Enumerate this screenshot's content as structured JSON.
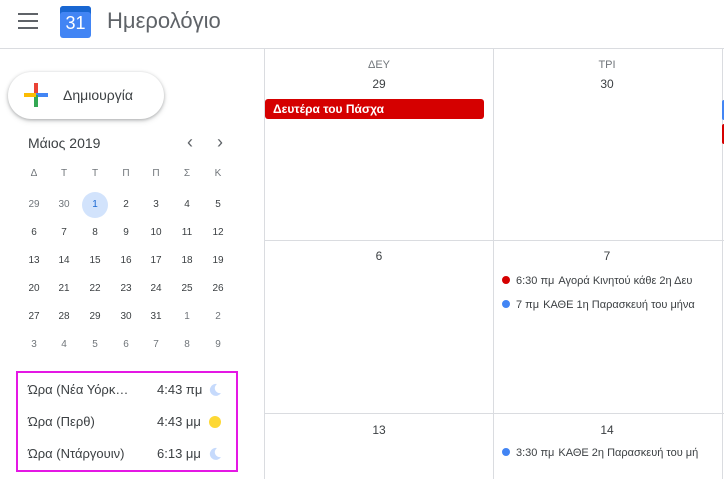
{
  "header": {
    "app_title": "Ημερολόγιο",
    "logo_day": "31"
  },
  "create_button": {
    "label": "Δημιουργία"
  },
  "mini_calendar": {
    "title": "Μάιος 2019",
    "prev": "‹",
    "next": "›",
    "weekday_headers": [
      "Δ",
      "Τ",
      "Τ",
      "Π",
      "Π",
      "Σ",
      "Κ"
    ],
    "weeks": [
      [
        "29",
        "30",
        "1",
        "2",
        "3",
        "4",
        "5"
      ],
      [
        "6",
        "7",
        "8",
        "9",
        "10",
        "11",
        "12"
      ],
      [
        "13",
        "14",
        "15",
        "16",
        "17",
        "18",
        "19"
      ],
      [
        "20",
        "21",
        "22",
        "23",
        "24",
        "25",
        "26"
      ],
      [
        "27",
        "28",
        "29",
        "30",
        "31",
        "1",
        "2"
      ],
      [
        "3",
        "4",
        "5",
        "6",
        "7",
        "8",
        "9"
      ]
    ],
    "today": "1"
  },
  "timezones": [
    {
      "name": "Ώρα (Νέα Υόρκ…",
      "time": "4:43 πμ",
      "icon": "moon-icon"
    },
    {
      "name": "Ώρα (Περθ)",
      "time": "4:43 μμ",
      "icon": "sun-icon"
    },
    {
      "name": "Ώρα (Ντάργουιν)",
      "time": "6:13 μμ",
      "icon": "moon-icon"
    }
  ],
  "calendar": {
    "columns": [
      {
        "dow": "ΔΕΥ",
        "dates": [
          "29",
          "6",
          "13"
        ]
      },
      {
        "dow": "ΤΡΙ",
        "dates": [
          "30",
          "7",
          "14"
        ]
      }
    ],
    "allday_event": {
      "title": "Δευτέρα του Πάσχα",
      "color": "#d50000"
    },
    "events": [
      {
        "time": "6:30 πμ",
        "title": "Αγορά Κινητού κάθε 2η Δευ",
        "color": "#d50000"
      },
      {
        "time": "7 πμ",
        "title": "ΚΑΘΕ 1η Παρασκευή του μήνα",
        "color": "#4285f4"
      },
      {
        "time": "3:30 πμ",
        "title": "ΚΑΘΕ 2η Παρασκευή του μή",
        "color": "#4285f4"
      }
    ]
  },
  "colors": {
    "highlight_border": "#e418e4",
    "today_bg": "#d2e3fc",
    "accent": "#1967d2"
  }
}
